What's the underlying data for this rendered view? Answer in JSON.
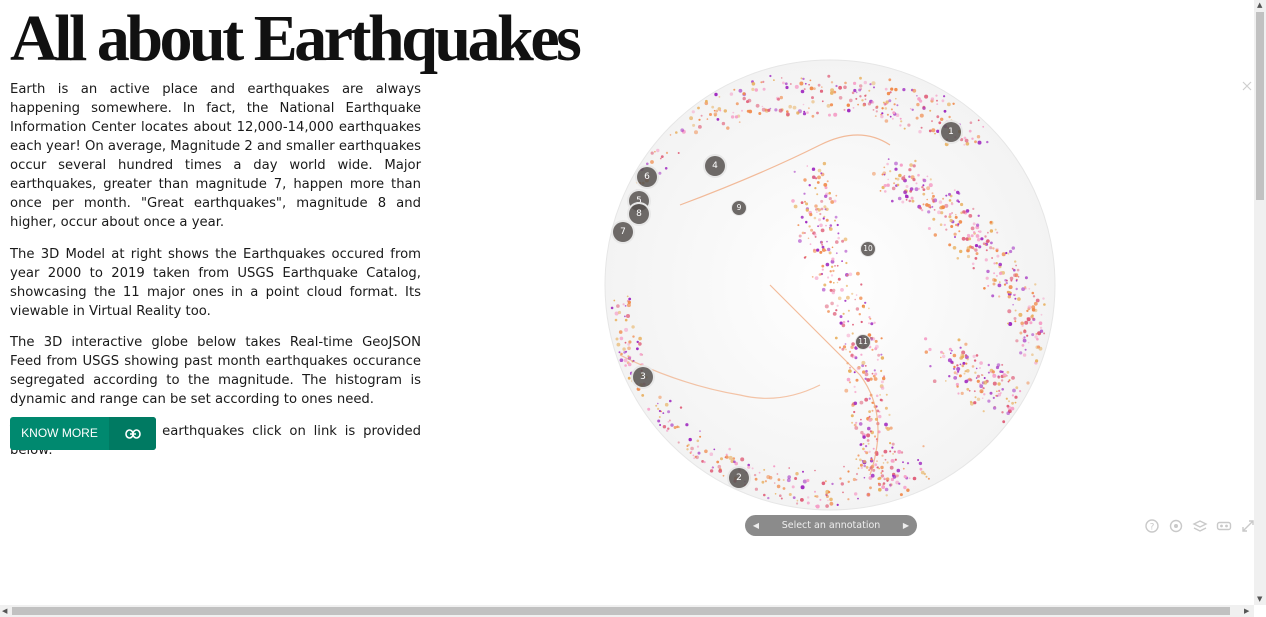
{
  "header": {
    "title": "All about Earthquakes"
  },
  "content": {
    "paragraphs": [
      "Earth is an active place and earthquakes are always happening somewhere. In fact, the National Earthquake Information Center locates about 12,000-14,000 earthquakes each year! On average, Magnitude 2 and smaller earthquakes occur several hundred times a day world wide. Major earthquakes, greater than magnitude 7, happen more than once per month. \"Great earthquakes\", magnitude 8 and higher, occur about once a year.",
      "The 3D Model at right shows the Earthquakes occured from year 2000 to 2019 taken from USGS Earthquake Catalog, showcasing the 11 major ones in a point cloud format. Its viewable in Virtual Reality too.",
      "The 3D interactive globe below takes Real-time GeoJSON Feed from USGS showing past month earthquakes occurance segregated according to the magnitude. The histogram is dynamic and range can be set according to ones need.",
      "To know more about earthquakes click on link is provided below:"
    ],
    "button": {
      "label": "KNOW MORE",
      "icon": "link-icon",
      "color": "#00896f"
    }
  },
  "viewer": {
    "annotations": [
      "1",
      "2",
      "3",
      "4",
      "5",
      "6",
      "7",
      "8",
      "9",
      "10",
      "11"
    ],
    "annotation_bar": {
      "label": "Select an annotation",
      "prev_icon": "triangle-left-icon",
      "next_icon": "triangle-right-icon"
    },
    "controls": [
      "help-icon",
      "settings-icon",
      "layers-icon",
      "vr-icon",
      "fullscreen-icon"
    ],
    "point_colors": [
      "#e0607a",
      "#f08a4b",
      "#a02ac0",
      "#f5a0c8",
      "#e8b060"
    ]
  }
}
